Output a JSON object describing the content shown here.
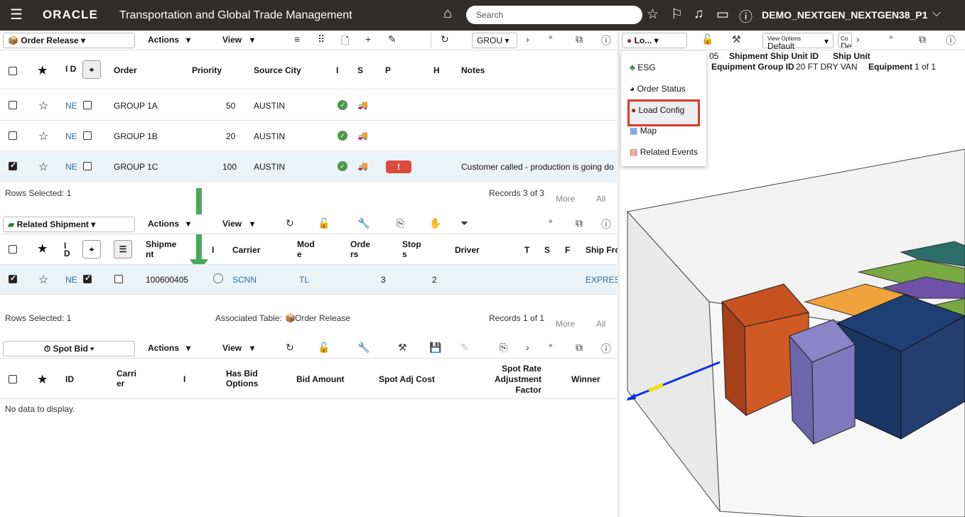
{
  "header": {
    "brand": "ORACLE",
    "title": "Transportation and Global Trade Management",
    "search_placeholder": "Search",
    "user": "DEMO_NEXTGEN_NEXTGEN38_P1"
  },
  "or_toolbar": {
    "object": "Order Release",
    "actions": "Actions",
    "view": "View",
    "group_field": "GROU"
  },
  "or_columns": [
    "I D",
    "Order",
    "Priority",
    "Source City",
    "I",
    "S",
    "P",
    "H",
    "Notes"
  ],
  "or_rows": [
    {
      "id": "NE",
      "order": "GROUP 1A",
      "priority": "50",
      "city": "AUSTIN",
      "notes": ""
    },
    {
      "id": "NE",
      "order": "GROUP 1B",
      "priority": "20",
      "city": "AUSTIN",
      "notes": ""
    },
    {
      "id": "NE",
      "order": "GROUP 1C",
      "priority": "100",
      "city": "AUSTIN",
      "notes": "Customer called - production is going do"
    }
  ],
  "or_footer": {
    "rows_selected": "Rows Selected: 1",
    "records": "Records 3 of 3",
    "more": "More",
    "all": "All"
  },
  "rs_toolbar": {
    "object": "Related Shipment",
    "actions": "Actions",
    "view": "View"
  },
  "rs_columns": {
    "id": "I D",
    "shipment": "Shipme nt",
    "i": "I",
    "carrier": "Carrier",
    "mode": "Mod e",
    "orders": "Orde rs",
    "stops": "Stop s",
    "driver": "Driver",
    "t": "T",
    "s": "S",
    "f": "F",
    "shipfrom": "Ship Fro"
  },
  "rs_row": {
    "id": "NE",
    "shipment": "100600405",
    "carrier": "SCNN",
    "mode": "TL",
    "orders": "3",
    "stops": "2",
    "shipfrom": "EXPRES"
  },
  "rs_footer": {
    "rows_selected": "Rows Selected: 1",
    "assoc_label": "Associated Table:",
    "assoc_table": "Order Release",
    "records": "Records 1 of 1",
    "more": "More",
    "all": "All"
  },
  "sb_toolbar": {
    "object": "Spot Bid",
    "actions": "Actions",
    "view": "View"
  },
  "sb_columns": {
    "id": "ID",
    "carrier": "Carri er",
    "i": "I",
    "has_bid": "Has Bid Options",
    "bid_amount": "Bid Amount",
    "spot_adj": "Spot Adj Cost",
    "spot_rate": "Spot Rate Adjustment Factor",
    "winner": "Winner"
  },
  "sb_empty": "No data to display.",
  "right": {
    "panel": "Lo...",
    "view_options_label": "View Options",
    "view_options_value": "Default",
    "co_label": "Co",
    "co_value": "De",
    "info1a": "05",
    "info1b": "Shipment Ship Unit ID",
    "info1c": "Ship Unit",
    "info2a": "Equipment Group ID",
    "info2b": "20 FT DRY VAN",
    "info2c": "Equipment",
    "info2d": "1 of 1"
  },
  "menu": {
    "items": [
      "ESG",
      "Order Status",
      "Load Config",
      "Map",
      "Related Events"
    ]
  },
  "colors": {
    "header": "#312d2a",
    "highlight": "#e0362a",
    "arrow": "#4aa85a"
  }
}
